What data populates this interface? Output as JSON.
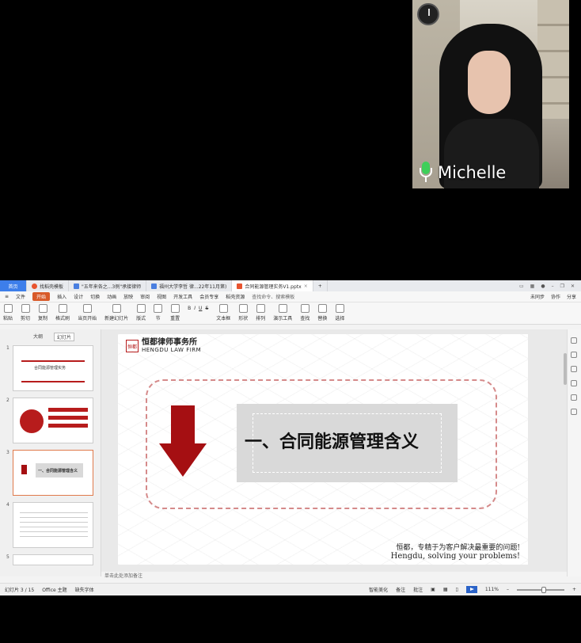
{
  "video": {
    "participant_name": "Michelle"
  },
  "wps": {
    "tabs": [
      {
        "label": "首页",
        "active": false
      },
      {
        "label": "找稻壳模板"
      },
      {
        "label": "\"五年来各之...3例\"承接律师"
      },
      {
        "label": "福州大学李哲 律...22年11月第)"
      },
      {
        "label": "合同能源管理实务V1.pptx",
        "active": true
      }
    ],
    "menubar": {
      "items": [
        "文件",
        "开始",
        "插入",
        "设计",
        "切换",
        "动画",
        "放映",
        "审阅",
        "视图",
        "开发工具",
        "会员专享",
        "稻壳资源"
      ],
      "search": "查找命令、搜索模板",
      "right": [
        "未同步",
        "协作",
        "分享"
      ]
    },
    "ribbon": {
      "buttons": [
        "粘贴",
        "剪切",
        "复制",
        "格式刷",
        "当页开始",
        "新建幻灯片",
        "版式",
        "节",
        "重置",
        "文本框",
        "形状",
        "排列",
        "演示工具",
        "查找",
        "替换",
        "选择"
      ]
    },
    "left_pane": {
      "tabs": [
        "大纲",
        "幻灯片"
      ],
      "thumbs": [
        {
          "num": "1",
          "title": "合同能源管理实务"
        },
        {
          "num": "2",
          "title": ""
        },
        {
          "num": "3",
          "title": "一、合同能源管理含义"
        },
        {
          "num": "4",
          "title": ""
        },
        {
          "num": "5",
          "title": ""
        }
      ],
      "add_symbol": "+"
    },
    "slide": {
      "logo_seal": "恒都",
      "logo_cn": "恒都律师事务所",
      "logo_en": "HENGDU LAW FIRM",
      "title": "一、合同能源管理含义",
      "slogan_cn": "恒都，专精于为客户解决最重要的问题!",
      "slogan_en": "Hengdu, solving your problems!"
    },
    "notes_placeholder": "单击此处添加备注",
    "status": {
      "slide_pos": "幻灯片 3 / 15",
      "theme": "Office 主题",
      "font_missing": "缺失字体",
      "smart_beautify": "智能美化",
      "notes": "备注",
      "comments": "批注",
      "zoom": "111%",
      "zoom_fraction": 0.57
    },
    "colors": {
      "accent": "#a50f12",
      "wps_blue": "#3d7eea",
      "start_tab": "#d85a29"
    }
  }
}
